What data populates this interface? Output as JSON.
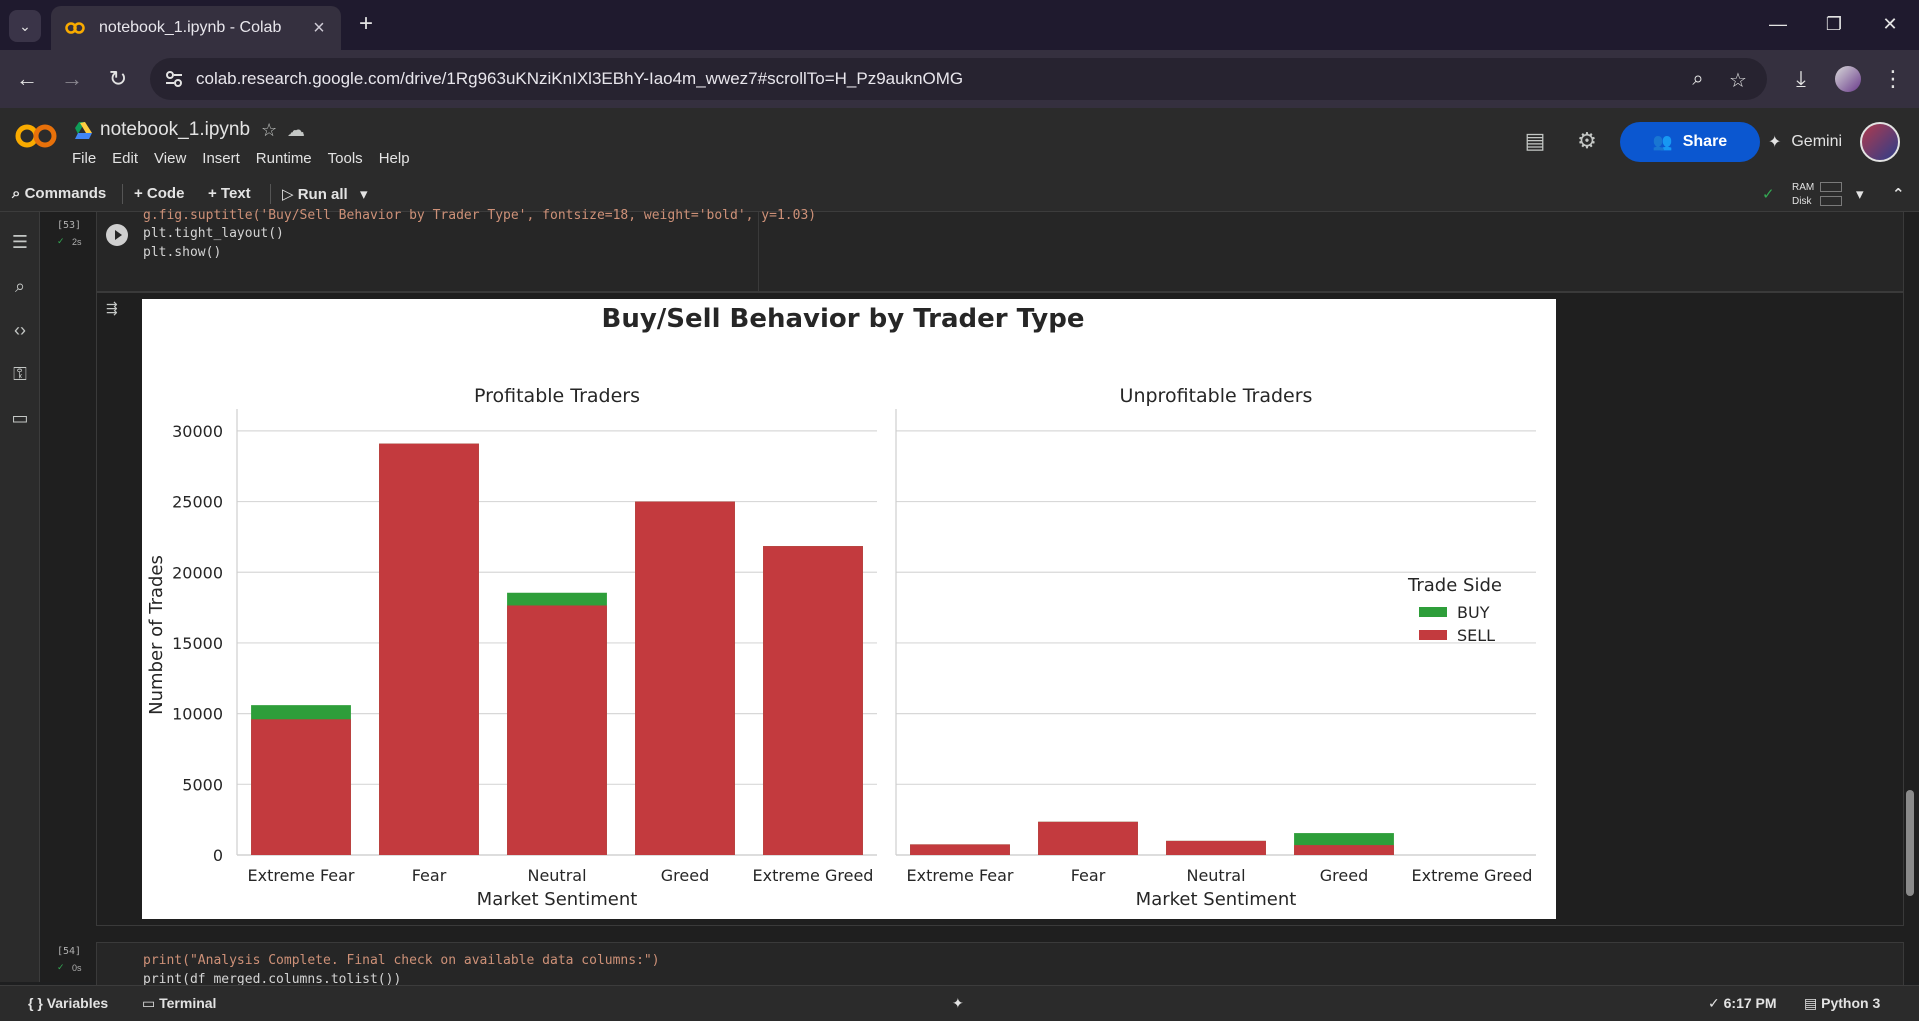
{
  "browser": {
    "tab_title": "notebook_1.ipynb - Colab",
    "url": "colab.research.google.com/drive/1Rg963uKNziKnIXl3EBhY-Iao4m_wwez7#scrollTo=H_Pz9auknOMG"
  },
  "colab": {
    "notebook_title": "notebook_1.ipynb",
    "menu": [
      "File",
      "Edit",
      "View",
      "Insert",
      "Runtime",
      "Tools",
      "Help"
    ],
    "share_label": "Share",
    "gemini_label": "Gemini",
    "commands_label": "Commands",
    "add_code_label": "+ Code",
    "add_text_label": "+ Text",
    "run_all_label": "Run all",
    "ram_label": "RAM",
    "disk_label": "Disk"
  },
  "cells": {
    "cell53": {
      "count": "[53]",
      "time": "2s",
      "lines": [
        "g.fig.suptitle('Buy/Sell Behavior by Trader Type', fontsize=18, weight='bold', y=1.03)",
        "plt.tight_layout()",
        "plt.show()"
      ]
    },
    "cell54": {
      "count": "[54]",
      "time": "0s",
      "lines": [
        "print(\"Analysis Complete. Final check on available data columns:\")",
        "print(df_merged.columns.tolist())"
      ]
    }
  },
  "chart_data": {
    "type": "bar",
    "title": "Buy/Sell Behavior by Trader Type",
    "ylabel": "Number of Trades",
    "ylim": [
      0,
      30000
    ],
    "yticks": [
      0,
      5000,
      10000,
      15000,
      20000,
      25000,
      30000
    ],
    "categories": [
      "Extreme Fear",
      "Fear",
      "Neutral",
      "Greed",
      "Extreme Greed"
    ],
    "legend": {
      "title": "Trade Side",
      "position": "right"
    },
    "series_colors": {
      "BUY": "#2e9e3a",
      "SELL": "#c33a3e"
    },
    "panels": [
      {
        "title": "Profitable Traders",
        "xlabel": "Market Sentiment",
        "series": [
          {
            "name": "BUY",
            "values": [
              10600,
              29100,
              18550,
              25000,
              21850
            ]
          },
          {
            "name": "SELL",
            "values": [
              9600,
              29100,
              17650,
              25000,
              21850
            ]
          }
        ]
      },
      {
        "title": "Unprofitable Traders",
        "xlabel": "Market Sentiment",
        "series": [
          {
            "name": "BUY",
            "values": [
              750,
              2350,
              1000,
              1550,
              0
            ]
          },
          {
            "name": "SELL",
            "values": [
              750,
              2350,
              1000,
              700,
              0
            ]
          }
        ]
      }
    ]
  },
  "status": {
    "variables_label": "Variables",
    "terminal_label": "Terminal",
    "time": "6:17 PM",
    "runtime": "Python 3"
  }
}
